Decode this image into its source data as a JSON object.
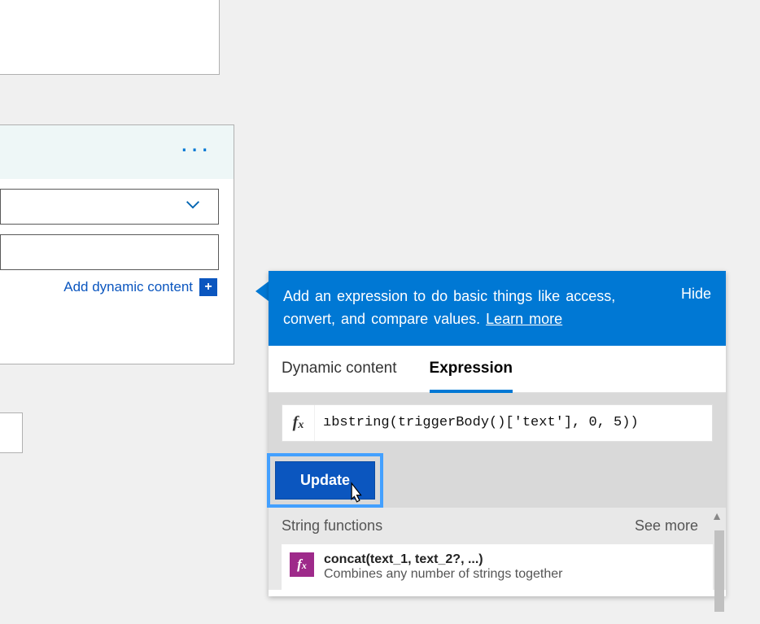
{
  "left_panel": {
    "add_dynamic_content": "Add dynamic content"
  },
  "panel": {
    "header_text_1": "Add an expression to do basic things like access, convert, and compare values. ",
    "learn_more": "Learn more",
    "hide": "Hide",
    "tabs": {
      "dynamic": "Dynamic content",
      "expression": "Expression"
    },
    "expression_value": "ıbstring(triggerBody()['text'], 0, 5))",
    "update_label": "Update",
    "section_title": "String functions",
    "see_more": "See more",
    "functions": [
      {
        "title": "concat(text_1, text_2?, ...)",
        "description": "Combines any number of strings together"
      }
    ]
  }
}
